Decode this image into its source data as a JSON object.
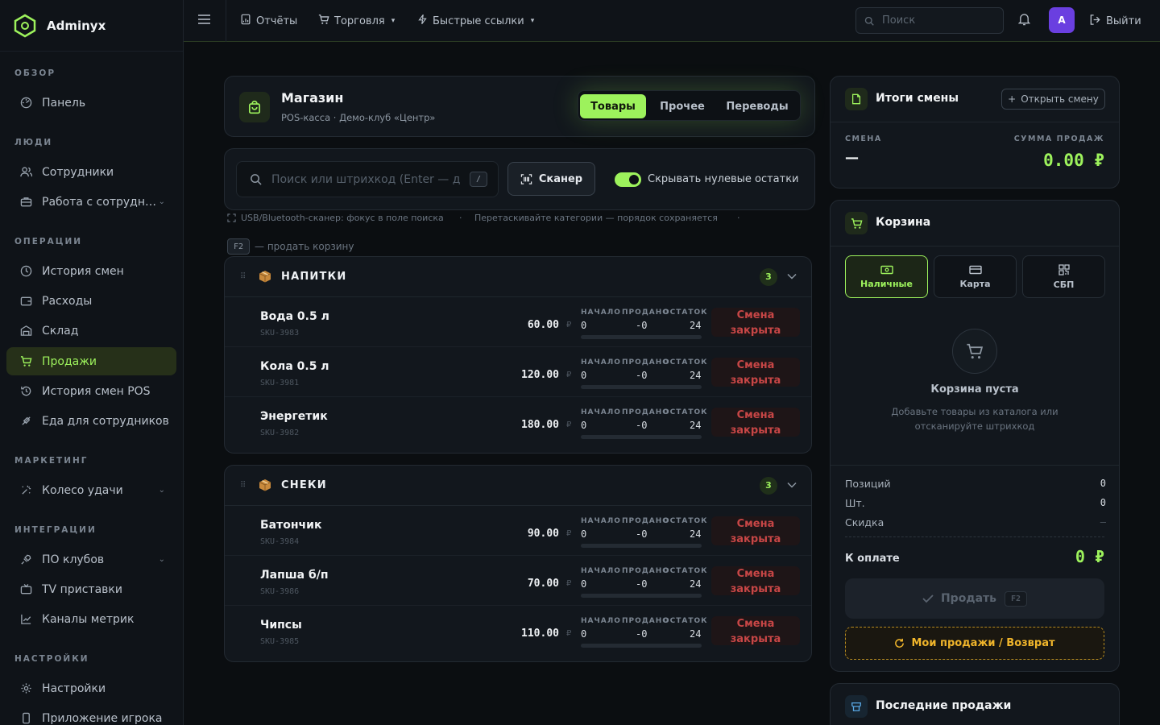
{
  "brand": {
    "name": "Adminyx"
  },
  "sidebar": {
    "sections": [
      {
        "title": "ОБЗОР"
      },
      {
        "title": "ЛЮДИ"
      },
      {
        "title": "ОПЕРАЦИИ"
      },
      {
        "title": "МАРКЕТИНГ"
      },
      {
        "title": "ИНТЕГРАЦИИ"
      },
      {
        "title": "НАСТРОЙКИ"
      }
    ],
    "items": [
      {
        "label": "Панель",
        "icon": "dashboard-icon"
      },
      {
        "label": "Сотрудники",
        "icon": "users-icon"
      },
      {
        "label": "Работа с сотрудн…",
        "icon": "briefcase-icon",
        "has_submenu": true
      },
      {
        "label": "История смен",
        "icon": "clock-icon"
      },
      {
        "label": "Расходы",
        "icon": "wallet-icon"
      },
      {
        "label": "Склад",
        "icon": "warehouse-icon"
      },
      {
        "label": "Продажи",
        "icon": "cart-icon",
        "active": true
      },
      {
        "label": "История смен POS",
        "icon": "history-icon"
      },
      {
        "label": "Еда для сотрудников",
        "icon": "food-icon"
      },
      {
        "label": "Колесо удачи",
        "icon": "wheel-icon",
        "has_submenu": true
      },
      {
        "label": "ПО клубов",
        "icon": "plug-icon",
        "has_submenu": true
      },
      {
        "label": "TV приставки",
        "icon": "tv-icon"
      },
      {
        "label": "Каналы метрик",
        "icon": "chart-icon"
      },
      {
        "label": "Настройки",
        "icon": "gear-icon"
      },
      {
        "label": "Приложение игрока",
        "icon": "phone-icon"
      }
    ]
  },
  "topbar": {
    "reports": "Отчёты",
    "trade": "Торговля",
    "quick_links": "Быстрые ссылки",
    "search_placeholder": "Поиск",
    "avatar_letter": "A",
    "logout": "Выйти"
  },
  "store": {
    "title": "Магазин",
    "subtitle": "POS-касса · Демо-клуб «Центр»",
    "tabs": [
      "Товары",
      "Прочее",
      "Переводы"
    ],
    "active_tab": 0
  },
  "search": {
    "placeholder": "Поиск или штрихкод (Enter — д",
    "shortcut": "/",
    "scanner_label": "Сканер",
    "hide_zero_label": "Скрывать нулевые остатки",
    "hide_zero_on": true
  },
  "hints": {
    "scanner": "USB/Bluetooth-сканер: фокус в поле поиска",
    "dot": "·",
    "drag": "Перетаскивайте категории — порядок сохраняется",
    "f2_key": "F2",
    "f2_text": "— продать корзину"
  },
  "stat_labels": {
    "start": "НАЧАЛО",
    "sold": "ПРОДАНО",
    "left": "ОСТАТОК"
  },
  "currency_sign": "₽",
  "closed_label": "Смена закрыта",
  "categories": [
    {
      "name": "НАПИТКИ",
      "count": "3",
      "items": [
        {
          "name": "Вода 0.5 л",
          "sku": "SKU-3983",
          "price": "60.00",
          "start": "0",
          "sold": "-0",
          "left": "24"
        },
        {
          "name": "Кола 0.5 л",
          "sku": "SKU-3981",
          "price": "120.00",
          "start": "0",
          "sold": "-0",
          "left": "24"
        },
        {
          "name": "Энергетик",
          "sku": "SKU-3982",
          "price": "180.00",
          "start": "0",
          "sold": "-0",
          "left": "24"
        }
      ]
    },
    {
      "name": "СНЕКИ",
      "count": "3",
      "items": [
        {
          "name": "Батончик",
          "sku": "SKU-3984",
          "price": "90.00",
          "start": "0",
          "sold": "-0",
          "left": "24"
        },
        {
          "name": "Лапша б/п",
          "sku": "SKU-3986",
          "price": "70.00",
          "start": "0",
          "sold": "-0",
          "left": "24"
        },
        {
          "name": "Чипсы",
          "sku": "SKU-3985",
          "price": "110.00",
          "start": "0",
          "sold": "-0",
          "left": "24"
        }
      ]
    }
  ],
  "shift": {
    "title": "Итоги смены",
    "open_button": "Открыть смену",
    "shift_label": "СМЕНА",
    "shift_value": "—",
    "sales_label": "СУММА ПРОДАЖ",
    "sales_value": "0.00 ₽"
  },
  "cart": {
    "title": "Корзина",
    "payment_methods": [
      "Наличные",
      "Карта",
      "СБП"
    ],
    "active_method": 0,
    "empty_title": "Корзина пуста",
    "empty_text_1": "Добавьте товары из каталога или",
    "empty_text_2": "отсканируйте штрихкод",
    "positions_label": "Позиций",
    "positions_value": "0",
    "qty_label": "Шт.",
    "qty_value": "0",
    "discount_label": "Скидка",
    "discount_value": "—",
    "total_label": "К оплате",
    "total_value": "0 ₽",
    "sell_label": "Продать",
    "sell_shortcut": "F2",
    "returns_label": "Мои продажи / Возврат"
  },
  "last_sales": {
    "title": "Последние продажи"
  },
  "colors": {
    "accent": "#9df25c",
    "danger": "#c74646",
    "warning": "#f0b52b",
    "bg": "#0b0e11"
  }
}
